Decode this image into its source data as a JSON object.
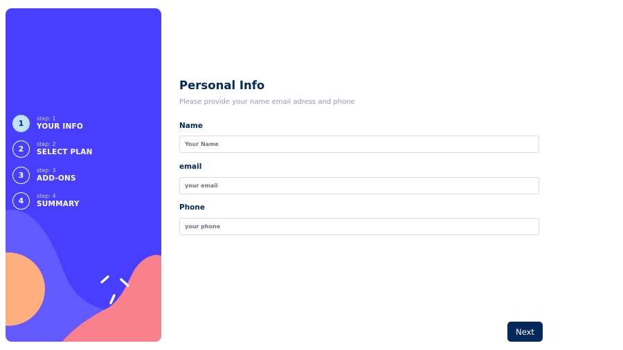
{
  "sidebar": {
    "steps": [
      {
        "number": "1",
        "sub": "step: 1",
        "title": "YOUR INFO",
        "active": true
      },
      {
        "number": "2",
        "sub": "step: 2",
        "title": "SELECT PLAN",
        "active": false
      },
      {
        "number": "3",
        "sub": "step: 3",
        "title": "ADD-ONS",
        "active": false
      },
      {
        "number": "4",
        "sub": "step: 4",
        "title": "SUMMARY",
        "active": false
      }
    ]
  },
  "form": {
    "heading": "Personal Info",
    "subheading": "Please provide your name email adress and phone",
    "name": {
      "label": "Name",
      "placeholder": "Your Name",
      "value": ""
    },
    "email": {
      "label": "email",
      "placeholder": "your email",
      "value": ""
    },
    "phone": {
      "label": "Phone",
      "placeholder": "your phone",
      "value": ""
    }
  },
  "actions": {
    "next_label": "Next"
  },
  "colors": {
    "sidebar_bg": "#483eff",
    "active_step": "#bee2fd",
    "marine_blue": "#02295a",
    "wave_light": "#6259ff",
    "orange_circle": "#ffaf7e",
    "pink_blob": "#f9818e",
    "border": "#d6d9e6",
    "muted_text": "#9699ab"
  }
}
